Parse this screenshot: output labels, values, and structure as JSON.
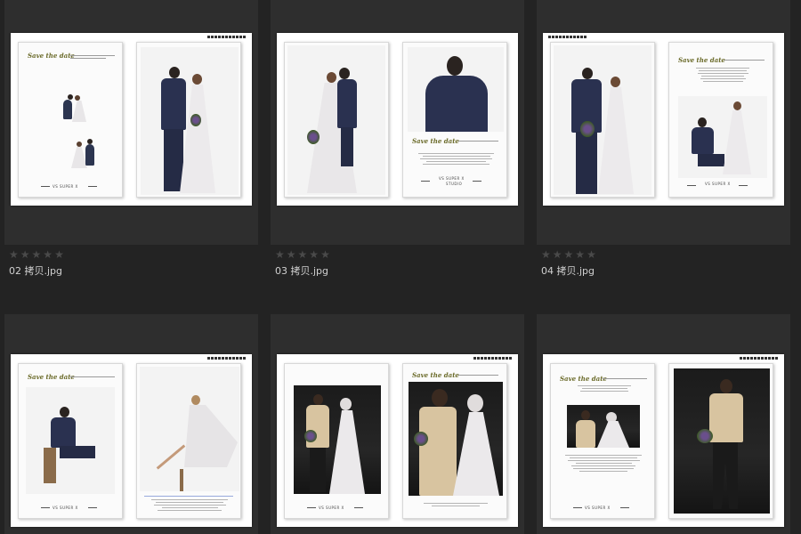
{
  "thumbnails": [
    {
      "filename": "02 拷贝.jpg",
      "rating": 0
    },
    {
      "filename": "03 拷贝.jpg",
      "rating": 0
    },
    {
      "filename": "04 拷贝.jpg",
      "rating": 0
    },
    {
      "filename": "",
      "rating": 0
    },
    {
      "filename": "",
      "rating": 0
    },
    {
      "filename": "",
      "rating": 0
    }
  ],
  "album": {
    "heading": "Save the date",
    "signature": "VS SUPER X",
    "signature_sub": "STUDIO"
  },
  "colors": {
    "background": "#232323",
    "cell": "#2e2e2e",
    "star_empty": "#4a4a4a",
    "caption": "#d0d0d0"
  },
  "icons": {
    "rating": "star-icon"
  }
}
